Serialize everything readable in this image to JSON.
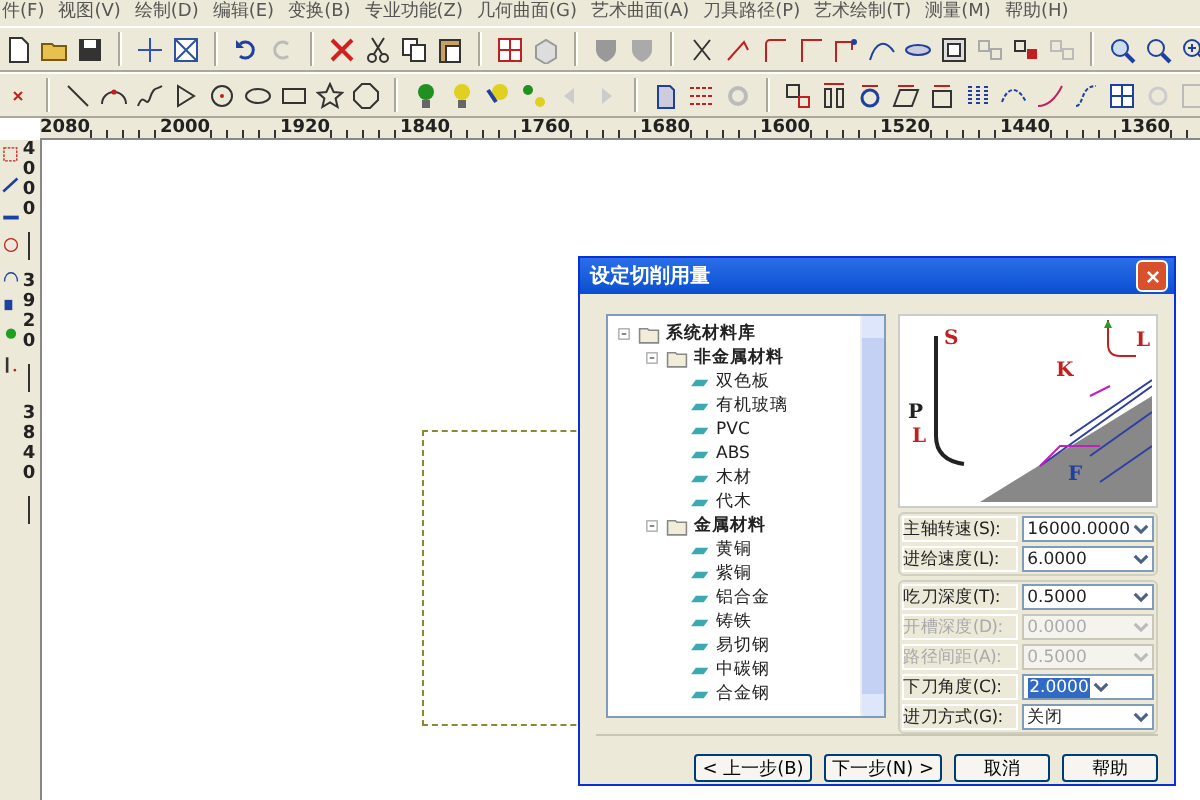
{
  "menu": [
    "件(F)",
    "视图(V)",
    "绘制(D)",
    "编辑(E)",
    "变换(B)",
    "专业功能(Z)",
    "几何曲面(G)",
    "艺术曲面(A)",
    "刀具路径(P)",
    "艺术绘制(T)",
    "测量(M)",
    "帮助(H)"
  ],
  "ruler_h": [
    "2080",
    "2000",
    "1920",
    "1840",
    "1760",
    "1680",
    "1600",
    "1520",
    "1440",
    "1360"
  ],
  "ruler_v": [
    "4000",
    "3920",
    "3840"
  ],
  "dialog": {
    "title": "设定切削用量",
    "tree": [
      {
        "label": "系统材料库",
        "expanded": true,
        "children": [
          {
            "label": "非金属材料",
            "expanded": true,
            "children": [
              {
                "label": "双色板"
              },
              {
                "label": "有机玻璃"
              },
              {
                "label": "PVC"
              },
              {
                "label": "ABS"
              },
              {
                "label": "木材"
              },
              {
                "label": "代木"
              }
            ]
          },
          {
            "label": "金属材料",
            "expanded": true,
            "children": [
              {
                "label": "黄铜"
              },
              {
                "label": "紫铜"
              },
              {
                "label": "铝合金"
              },
              {
                "label": "铸铁"
              },
              {
                "label": "易切钢"
              },
              {
                "label": "中碳钢"
              },
              {
                "label": "合金钢"
              }
            ]
          }
        ]
      }
    ],
    "diagram_labels": [
      "S",
      "P",
      "L",
      "K",
      "L",
      "F"
    ],
    "groups": [
      [
        {
          "label": "主轴转速(S):",
          "value": "16000.0000",
          "disabled": false,
          "selected": false
        },
        {
          "label": "进给速度(L):",
          "value": "6.0000",
          "disabled": false,
          "selected": false
        }
      ],
      [
        {
          "label": "吃刀深度(T):",
          "value": "0.5000",
          "disabled": false,
          "selected": false
        },
        {
          "label": "开槽深度(D):",
          "value": "0.0000",
          "disabled": true,
          "selected": false
        },
        {
          "label": "路径间距(A):",
          "value": "0.5000",
          "disabled": true,
          "selected": false
        },
        {
          "label": "下刀角度(C):",
          "value": "2.0000",
          "disabled": false,
          "selected": true
        },
        {
          "label": "进刀方式(G):",
          "value": "关闭",
          "disabled": false,
          "selected": false
        }
      ]
    ],
    "buttons": [
      "< 上一步(B)",
      "下一步(N) >",
      "取消",
      "帮助"
    ]
  }
}
